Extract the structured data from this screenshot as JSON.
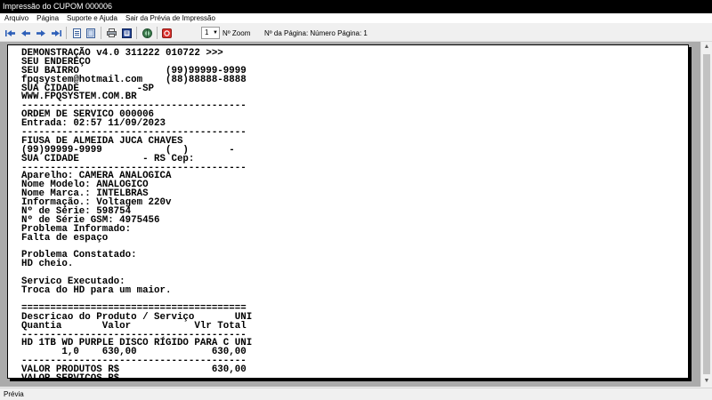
{
  "window": {
    "title": "Impressão do CUPOM 000006"
  },
  "menu": {
    "items": [
      "Arquivo",
      "Página",
      "Suporte e Ajuda",
      "Sair da Prévia de Impressão"
    ]
  },
  "toolbar": {
    "buttons": [
      {
        "name": "first-page-icon",
        "glyph": "⏮"
      },
      {
        "name": "previous-page-icon",
        "glyph": "◀"
      },
      {
        "name": "next-page-icon",
        "glyph": "▶"
      },
      {
        "name": "last-page-icon",
        "glyph": "⏭"
      },
      {
        "name": "single-page-icon",
        "glyph": ""
      },
      {
        "name": "two-pages-icon",
        "glyph": ""
      },
      {
        "name": "print-setup-icon",
        "glyph": ""
      },
      {
        "name": "page-setup-icon",
        "glyph": ""
      },
      {
        "name": "export-icon",
        "glyph": ""
      },
      {
        "name": "close-preview-icon",
        "glyph": ""
      }
    ],
    "zoom_value": "1",
    "zoom_label": "Nº Zoom",
    "page_label": "Nº da Página: Número Página: 1"
  },
  "receipt": {
    "lines": [
      "DEMONSTRAÇÃO v4.0 311222 010722 >>>",
      "SEU ENDEREÇO",
      "SEU BAIRRO               (99)99999-9999",
      "fpqsystem@hotmail.com    (88)88888-8888",
      "SUA CIDADE          -SP",
      "WWW.FPQSYSTEM.COM.BR",
      "---------------------------------------",
      "ORDEM DE SERVICO 000006",
      "Entrada: 02:57 11/09/2023",
      "---------------------------------------",
      "FIUSA DE ALMEIDA JUCA CHAVES",
      "(99)99999-9999           (  )       -",
      "SUA CIDADE           - RS Cep:",
      "---------------------------------------",
      "Aparelho: CAMERA ANALOGICA",
      "Nome Modelo: ANALOGICO",
      "Nome Marca.: INTELBRAS",
      "Informação.: Voltagem 220v",
      "Nº de Série: 598754",
      "Nº de Série GSM: 4975456",
      "Problema Informado:",
      "Falta de espaço",
      "",
      "Problema Constatado:",
      "HD cheio.",
      "",
      "Servico Executado:",
      "Troca do HD para um maior.",
      "",
      "=======================================",
      "Descricao do Produto / Serviço       UNI",
      "Quantia       Valor           Vlr Total",
      "---------------------------------------",
      "HD 1TB WD PURPLE DISCO RÍGIDO PARA C UNI",
      "       1,0    630,00             630,00",
      "---------------------------------------",
      "VALOR PRODUTOS R$                630,00",
      "VALOR SERVICOS R$"
    ]
  },
  "status": {
    "text": "Prévia"
  }
}
